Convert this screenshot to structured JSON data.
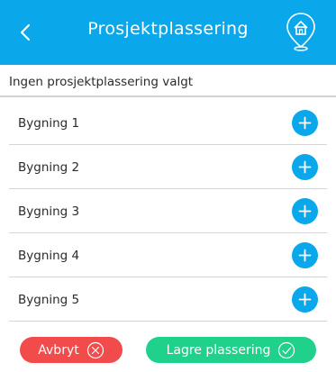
{
  "header": {
    "title": "Prosjektplassering",
    "back_icon": "chevron-left-icon",
    "location_icon": "home-location-pin-icon",
    "background": "#0aa7eb"
  },
  "status": {
    "text": "Ingen prosjektplassering valgt"
  },
  "buildings": [
    {
      "label": "Bygning 1"
    },
    {
      "label": "Bygning 2"
    },
    {
      "label": "Bygning 3"
    },
    {
      "label": "Bygning 4"
    },
    {
      "label": "Bygning 5"
    }
  ],
  "actions": {
    "cancel_label": "Avbryt",
    "cancel_color": "#f14b4b",
    "save_label": "Lagre plassering",
    "save_color": "#1fd18b"
  }
}
